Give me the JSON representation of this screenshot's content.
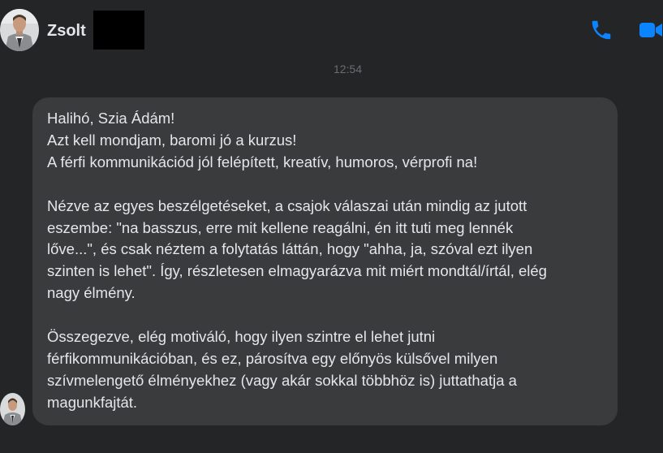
{
  "header": {
    "contact_name": "Zsolt",
    "avatar_icon": "profile-photo",
    "call_icon": "phone-icon",
    "video_icon": "video-camera-icon",
    "accent_color": "#0a84ff"
  },
  "conversation": {
    "timestamp": "12:54",
    "messages": [
      {
        "sender": "Zsolt",
        "text": "Halihó, Szia Ádám!\nAzt kell mondjam, baromi jó a kurzus!\nA férfi kommunikációd jól felépített, kreatív, humoros, vérprofi na!\n\nNézve az egyes beszélgetéseket, a csajok válaszai után mindig az jutott\neszembe: \"na basszus, erre mit kellene reagálni, én itt tuti meg lennék\nlőve...\", és csak néztem a folytatás láttán, hogy \"ahha, ja, szóval ezt ilyen\nszinten is lehet\". Így, részletesen elmagyarázva mit miért mondtál/írtál, elég\nnagy élmény.\n\nÖsszegezve, elég motiváló, hogy ilyen szintre el lehet jutni\nférfikommunikációban, és ez, párosítva egy előnyös külsővel milyen\nszívmelengető élményekhez (vagy akár sokkal többhöz is) juttathatja a\nmagunkfajtát."
      }
    ]
  }
}
